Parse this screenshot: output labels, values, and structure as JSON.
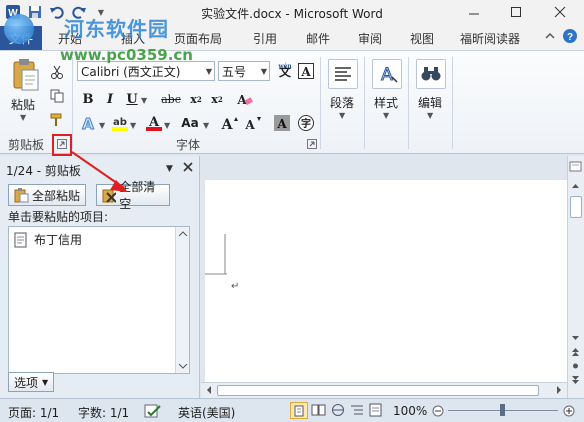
{
  "window": {
    "title": "实验文件.docx - Microsoft Word"
  },
  "tabs": [
    {
      "label": "文件"
    },
    {
      "label": "开始"
    },
    {
      "label": "插入"
    },
    {
      "label": "页面布局"
    },
    {
      "label": "引用"
    },
    {
      "label": "邮件"
    },
    {
      "label": "审阅"
    },
    {
      "label": "视图"
    },
    {
      "label": "福昕阅读器"
    }
  ],
  "watermark": {
    "name": "河东软件园",
    "url": "www.pc0359.cn"
  },
  "ribbon": {
    "clipboard": {
      "paste_label": "粘贴",
      "group_label": "剪贴板"
    },
    "font": {
      "font_name": "Calibri (西文正文)",
      "font_size": "五号",
      "group_label": "字体",
      "aa_label": "Aa"
    },
    "paragraph_label": "段落",
    "styles_label": "样式",
    "editing_label": "编辑"
  },
  "clipboard_pane": {
    "title": "1/24 - 剪贴板",
    "paste_all": "全部粘贴",
    "clear_all": "全部清空",
    "hint": "单击要粘贴的项目:",
    "items": [
      "布丁信用"
    ],
    "options": "选项"
  },
  "status": {
    "page": "页面: 1/1",
    "words": "字数: 1/1",
    "language": "英语(美国)",
    "zoom": "100%"
  },
  "colors": {
    "accent": "#2b579a",
    "annotation": "#e02020"
  }
}
